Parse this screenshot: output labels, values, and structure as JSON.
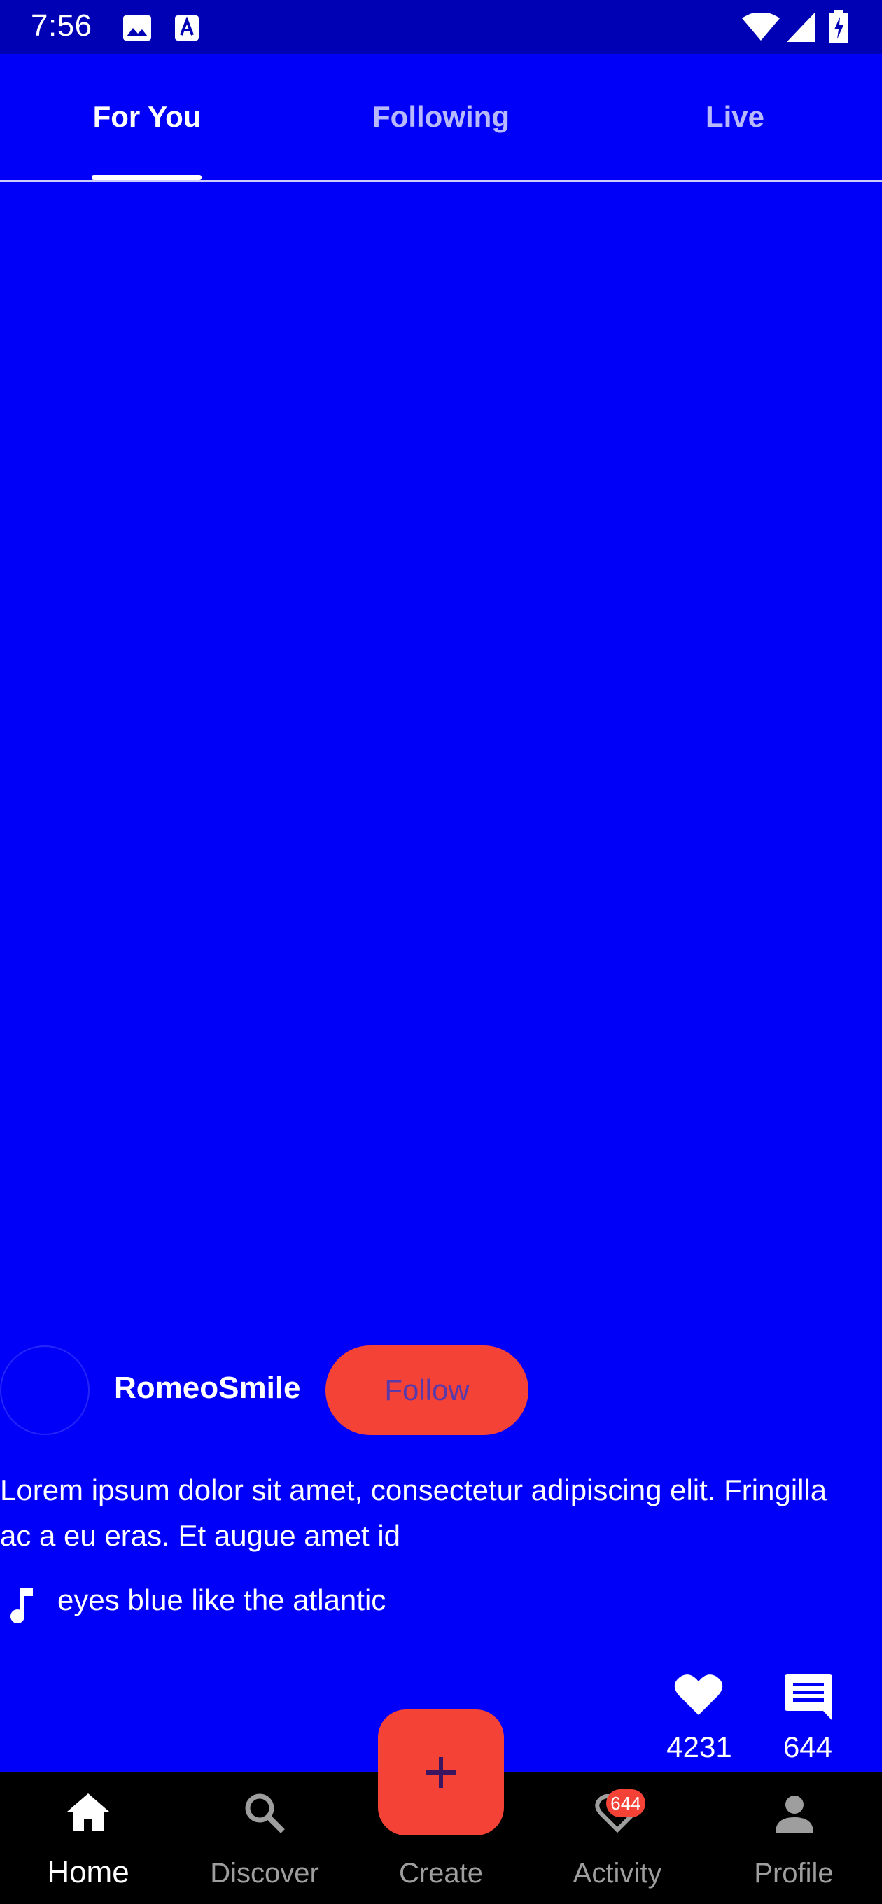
{
  "status_bar": {
    "time": "7:56"
  },
  "top_tabs": [
    {
      "label": "For You",
      "active": true
    },
    {
      "label": "Following",
      "active": false
    },
    {
      "label": "Live",
      "active": false
    }
  ],
  "post": {
    "username": "RomeoSmile",
    "follow_label": "Follow",
    "caption": "Lorem ipsum dolor sit amet, consectetur adipiscing elit. Fringilla ac a eu eras. Et augue amet id",
    "music_title": "eyes blue like the atlantic",
    "like_count": "4231",
    "comment_count": "644"
  },
  "bottom_nav": {
    "home": "Home",
    "discover": "Discover",
    "create": "Create",
    "activity": "Activity",
    "activity_badge": "644",
    "profile": "Profile"
  },
  "colors": {
    "background": "#0000f8",
    "status_bar": "#0000b4",
    "accent": "#f44336",
    "nav_background": "#000000"
  },
  "icons": [
    "image-icon",
    "text-icon",
    "wifi-icon",
    "signal-icon",
    "battery-icon",
    "music-note-icon",
    "heart-icon",
    "comment-icon",
    "home-icon",
    "search-icon",
    "plus-icon",
    "heart-outline-icon",
    "person-icon"
  ]
}
